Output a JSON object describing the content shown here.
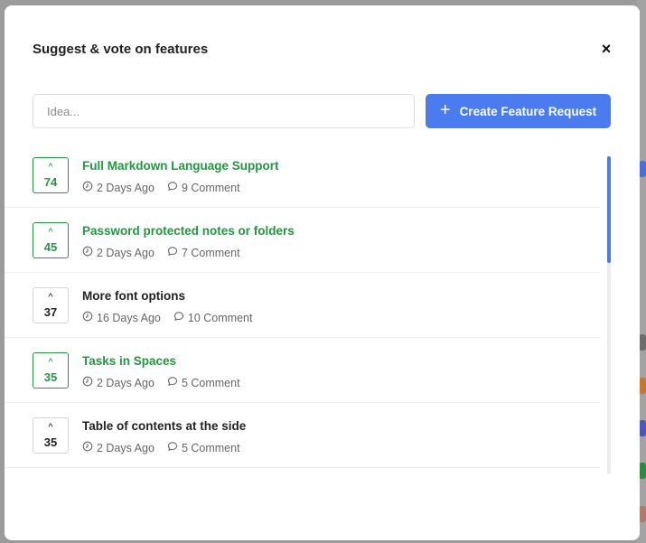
{
  "modal": {
    "title": "Suggest & vote on features",
    "close_label": "×"
  },
  "idea_input": {
    "placeholder": "Idea...",
    "value": ""
  },
  "create_button": {
    "label": "Create Feature Request",
    "icon": "plus-icon"
  },
  "features": [
    {
      "votes": "74",
      "title": "Full Markdown Language Support",
      "age": "2 Days Ago",
      "comments": "9 Comment",
      "voted": true
    },
    {
      "votes": "45",
      "title": "Password protected notes or folders",
      "age": "2 Days Ago",
      "comments": "7 Comment",
      "voted": true
    },
    {
      "votes": "37",
      "title": "More font options",
      "age": "16 Days Ago",
      "comments": "10 Comment",
      "voted": false
    },
    {
      "votes": "35",
      "title": "Tasks in Spaces",
      "age": "2 Days Ago",
      "comments": "5 Comment",
      "voted": true
    },
    {
      "votes": "35",
      "title": "Table of contents at the side",
      "age": "2 Days Ago",
      "comments": "5 Comment",
      "voted": false
    }
  ],
  "colors": {
    "accent": "#4a7cf0",
    "voted": "#1f9a3f",
    "text": "#222222",
    "muted": "#666666"
  },
  "icons": {
    "vote": "caret-up-icon",
    "age": "clock-icon",
    "comments": "comment-bubble-icon"
  }
}
